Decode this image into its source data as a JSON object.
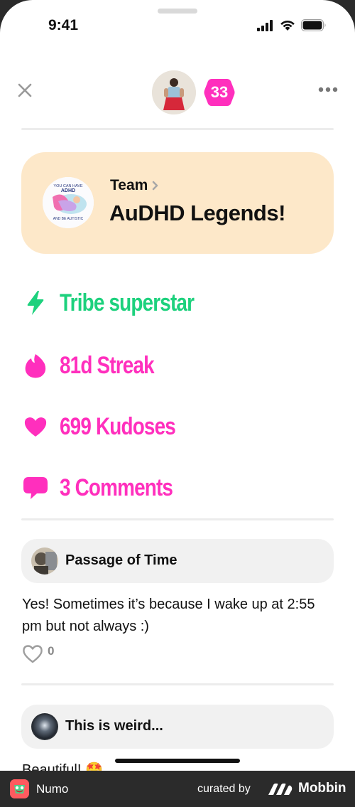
{
  "status_bar": {
    "time": "9:41"
  },
  "header": {
    "level": "33"
  },
  "team": {
    "kicker": "Team",
    "name": "AuDHD Legends!",
    "logo_text_top": "YOU CAN HAVE",
    "logo_text_mid": "ADHD",
    "logo_text_bottom": "AND BE AUTISTIC"
  },
  "stats": [
    {
      "label": "Tribe superstar",
      "icon": "lightning-icon",
      "color": "#1dd17d"
    },
    {
      "label": "81d Streak",
      "icon": "flame-icon",
      "color": "#ff2fbd"
    },
    {
      "label": "699 Kudoses",
      "icon": "heart-icon",
      "color": "#ff2fbd"
    },
    {
      "label": "3 Comments",
      "icon": "speech-bubble-icon",
      "color": "#ff2fbd"
    }
  ],
  "comments": [
    {
      "author": "Passage of Time",
      "text": "Yes! Sometimes it’s because I wake up at 2:55 pm but not always :)",
      "likes": "0"
    },
    {
      "author": "This is weird...",
      "text": "Beautiful! 🤩"
    }
  ],
  "footer": {
    "app_name": "Numo",
    "curated_by": "curated by",
    "brand": "Mobbin"
  },
  "colors": {
    "accent_pink": "#ff2fbd",
    "accent_green": "#1dd17d",
    "team_card_bg": "#fde8c9"
  }
}
